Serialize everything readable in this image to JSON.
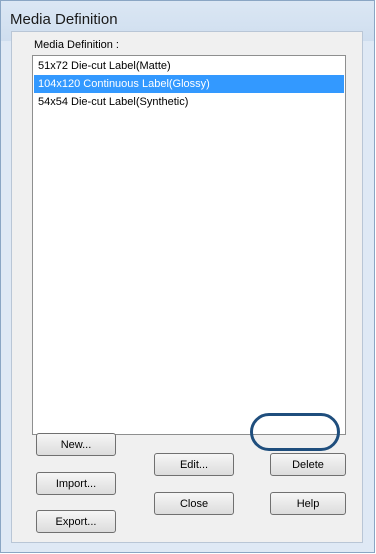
{
  "window": {
    "title": "Media Definition"
  },
  "group": {
    "label": "Media Definition :"
  },
  "list": {
    "items": [
      {
        "label": "51x72 Die-cut Label(Matte)"
      },
      {
        "label": "104x120 Continuous Label(Glossy)"
      },
      {
        "label": "54x54 Die-cut Label(Synthetic)"
      }
    ],
    "selected_index": 1
  },
  "buttons": {
    "new": "New...",
    "import": "Import...",
    "export": "Export...",
    "edit": "Edit...",
    "close": "Close",
    "delete": "Delete",
    "help": "Help"
  },
  "colors": {
    "selection": "#3399ff",
    "highlight_ring": "#1f4e7d"
  }
}
